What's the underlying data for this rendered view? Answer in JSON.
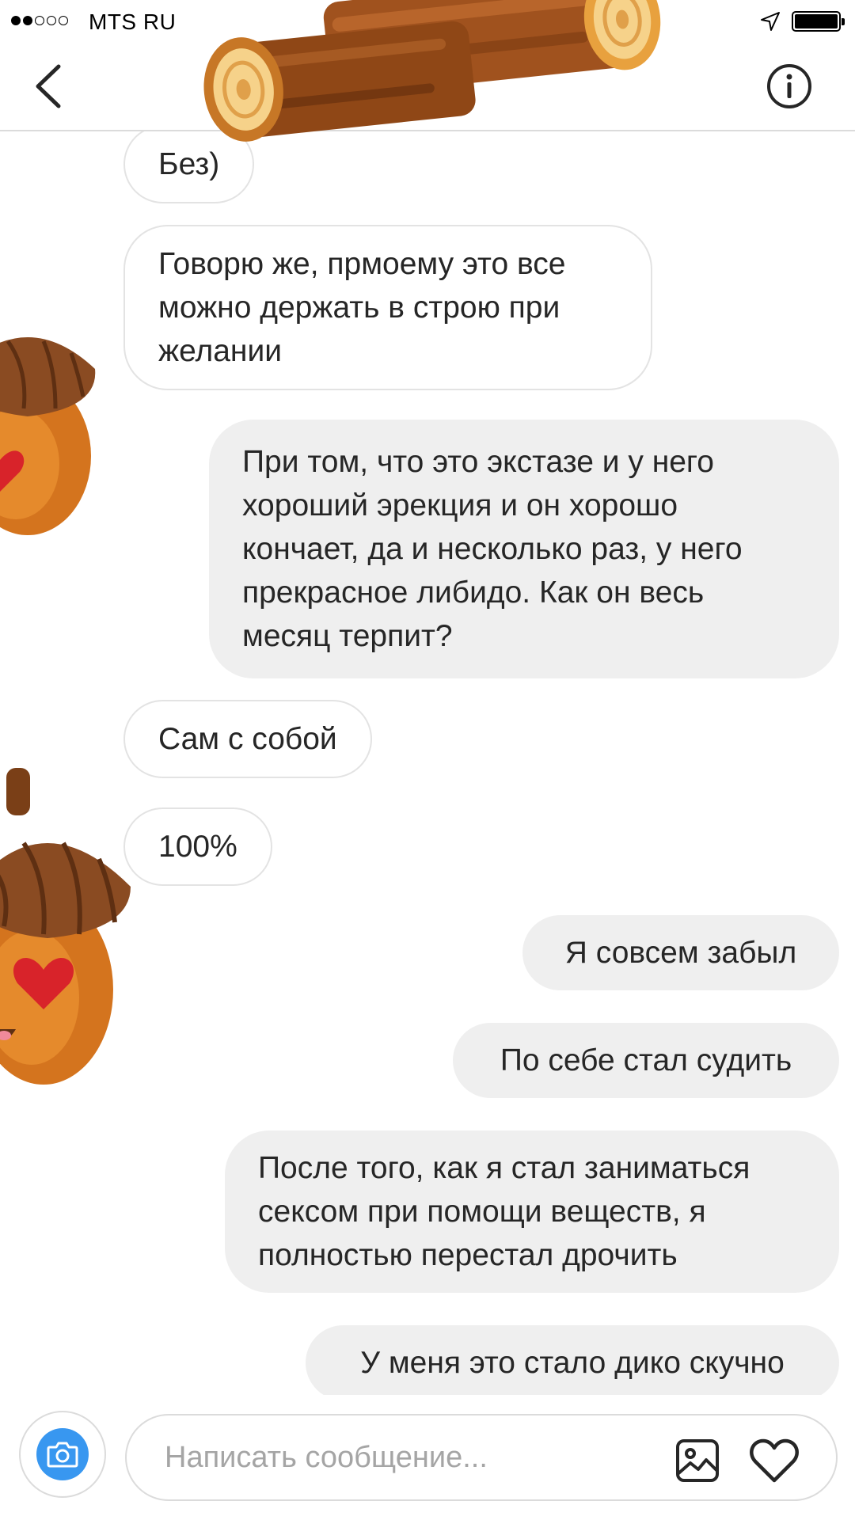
{
  "status_bar": {
    "carrier": "MTS RU",
    "signal_bars_filled": 2,
    "signal_bars_total": 5
  },
  "header": {
    "back_icon": "chevron-left-icon",
    "info_icon": "info-circle-icon",
    "sticker": "wooden-log-sticker"
  },
  "messages": [
    {
      "side": "in",
      "text": [
        "Без)"
      ]
    },
    {
      "side": "in",
      "text": [
        "Говорю же, прмоему это все",
        "можно держать в строю при",
        "желании"
      ]
    },
    {
      "side": "out",
      "text": [
        "При том, что это экстазе и у него",
        "хороший эрекция и он хорошо",
        "кончает, да и несколько раз, у него",
        "прекрасное либидо. Как он весь",
        "месяц терпит?"
      ]
    },
    {
      "side": "in",
      "text": [
        "Сам с собой"
      ]
    },
    {
      "side": "in",
      "text": [
        "100%"
      ]
    },
    {
      "side": "out",
      "text": [
        "Я совсем забыл"
      ]
    },
    {
      "side": "out",
      "text": [
        "По себе стал судить"
      ]
    },
    {
      "side": "out",
      "text": [
        "После того, как я стал заниматься",
        "сексом при помощи веществ, я",
        "полностью перестал дрочить"
      ]
    },
    {
      "side": "out",
      "text": [
        "У меня это стало дико скучно"
      ]
    }
  ],
  "composer": {
    "placeholder": "Написать сообщение...",
    "camera_icon": "camera-icon",
    "gallery_icon": "image-gallery-icon",
    "like_icon": "heart-icon"
  },
  "colors": {
    "accent": "#3897f0",
    "outgoing_bubble": "#efefef",
    "incoming_border": "#e3e3e3",
    "text": "#262626",
    "placeholder": "#a5a5a5"
  }
}
